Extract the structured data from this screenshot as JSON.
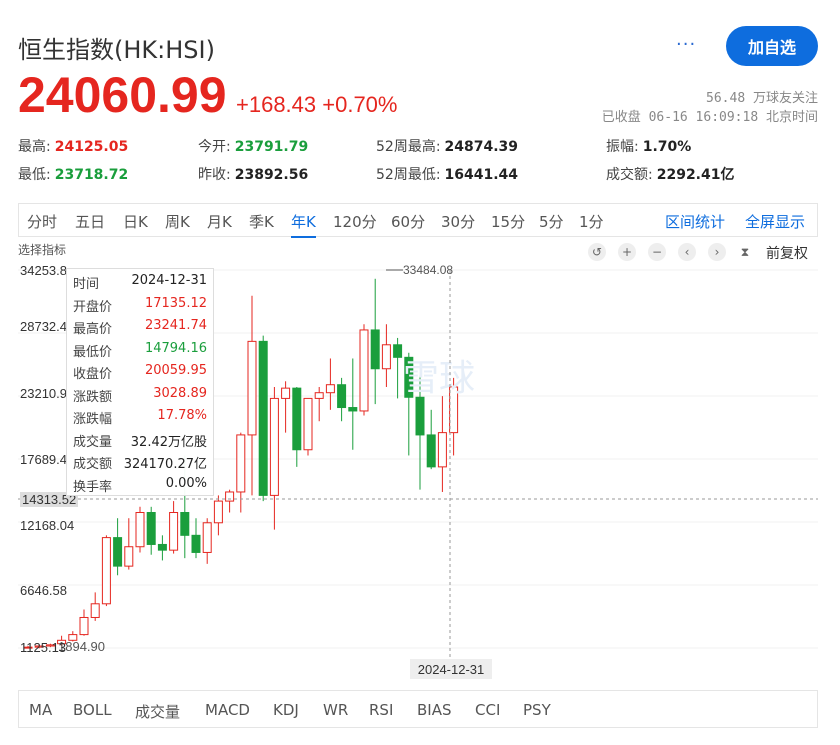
{
  "header": {
    "title": "恒生指数(HK:HSI)",
    "more_label": "···",
    "follow_button": "加自选",
    "price": "24060.99",
    "change": "+168.43 +0.70%",
    "follow_count": "56.48 万球友关注",
    "status": "已收盘 06-16 16:09:18 北京时间"
  },
  "stats": {
    "high_label": "最高:",
    "high": "24125.05",
    "low_label": "最低:",
    "low": "23718.72",
    "open_label": "今开:",
    "open": "23791.79",
    "prev_label": "昨收:",
    "prev": "23892.56",
    "w52h_label": "52周最高:",
    "w52h": "24874.39",
    "w52l_label": "52周最低:",
    "w52l": "16441.44",
    "amp_label": "振幅:",
    "amp": "1.70%",
    "turnover_label": "成交额:",
    "turnover": "2292.41亿"
  },
  "period_tabs": [
    "分时",
    "五日",
    "日K",
    "周K",
    "月K",
    "季K",
    "年K",
    "120分",
    "60分",
    "30分",
    "15分",
    "5分",
    "1分"
  ],
  "period_active": "年K",
  "right_links": {
    "stats": "区间统计",
    "fullscreen": "全屏显示"
  },
  "indicator_select": "选择指标",
  "toolbar": {
    "restore": "前复权"
  },
  "tooltip": {
    "time_label": "时间",
    "time": "2024-12-31",
    "open_label": "开盘价",
    "open": "17135.12",
    "high_label": "最高价",
    "high": "23241.74",
    "low_label": "最低价",
    "low": "14794.16",
    "close_label": "收盘价",
    "close": "20059.95",
    "chg_label": "涨跌额",
    "chg": "3028.89",
    "pct_label": "涨跌幅",
    "pct": "17.78%",
    "vol_label": "成交量",
    "vol": "32.42万亿股",
    "amt_label": "成交额",
    "amt": "324170.27亿",
    "turn_label": "换手率",
    "turn": "0.00%"
  },
  "watermark": "雪球",
  "crosshair_date": "2024-12-31",
  "crosshair_price": "14313.52",
  "max_annotation": "33484.08",
  "min_annotation": "1894.90",
  "indicator_tabs": [
    "MA",
    "BOLL",
    "成交量",
    "MACD",
    "KDJ",
    "WR",
    "RSI",
    "BIAS",
    "CCI",
    "PSY"
  ],
  "colors": {
    "up": "#e5261f",
    "down": "#1a9e3c",
    "accent": "#0e6dde"
  },
  "chart_data": {
    "type": "candlestick",
    "y_ticks": [
      "34253.8",
      "28732.4",
      "23210.9",
      "17689.4",
      "12168.04",
      "6646.58",
      "1125.13"
    ],
    "ylim": [
      1125.13,
      34253.8
    ],
    "candles": [
      {
        "o": 1125,
        "h": 1300,
        "l": 1125,
        "c": 1200
      },
      {
        "o": 1200,
        "h": 1400,
        "l": 1100,
        "c": 1300
      },
      {
        "o": 1300,
        "h": 1500,
        "l": 1200,
        "c": 1400
      },
      {
        "o": 1500,
        "h": 2200,
        "l": 1300,
        "c": 1800
      },
      {
        "o": 1800,
        "h": 2600,
        "l": 1700,
        "c": 2300
      },
      {
        "o": 2300,
        "h": 4500,
        "l": 2200,
        "c": 3800
      },
      {
        "o": 3800,
        "h": 6000,
        "l": 3500,
        "c": 5000
      },
      {
        "o": 5000,
        "h": 11000,
        "l": 4800,
        "c": 10800
      },
      {
        "o": 10800,
        "h": 12500,
        "l": 7500,
        "c": 8300
      },
      {
        "o": 8300,
        "h": 12500,
        "l": 8000,
        "c": 10000
      },
      {
        "o": 10000,
        "h": 13500,
        "l": 9500,
        "c": 13000
      },
      {
        "o": 13000,
        "h": 13500,
        "l": 9300,
        "c": 10200
      },
      {
        "o": 10200,
        "h": 11000,
        "l": 8800,
        "c": 9700
      },
      {
        "o": 9700,
        "h": 14000,
        "l": 9400,
        "c": 13000
      },
      {
        "o": 13000,
        "h": 18000,
        "l": 9000,
        "c": 11000
      },
      {
        "o": 11000,
        "h": 12500,
        "l": 9000,
        "c": 9500
      },
      {
        "o": 9500,
        "h": 12500,
        "l": 8500,
        "c": 12100
      },
      {
        "o": 12100,
        "h": 14500,
        "l": 11000,
        "c": 14000
      },
      {
        "o": 14000,
        "h": 15000,
        "l": 13000,
        "c": 14800
      },
      {
        "o": 14800,
        "h": 20000,
        "l": 13000,
        "c": 19800
      },
      {
        "o": 19800,
        "h": 32000,
        "l": 14500,
        "c": 28000
      },
      {
        "o": 28000,
        "h": 28500,
        "l": 14000,
        "c": 14500
      },
      {
        "o": 14500,
        "h": 24000,
        "l": 11500,
        "c": 23000
      },
      {
        "o": 23000,
        "h": 24500,
        "l": 20000,
        "c": 23900
      },
      {
        "o": 23900,
        "h": 24000,
        "l": 17000,
        "c": 18500
      },
      {
        "o": 18500,
        "h": 23000,
        "l": 18000,
        "c": 23000
      },
      {
        "o": 23000,
        "h": 24000,
        "l": 21000,
        "c": 23500
      },
      {
        "o": 23500,
        "h": 26500,
        "l": 22000,
        "c": 24200
      },
      {
        "o": 24200,
        "h": 24800,
        "l": 21000,
        "c": 22200
      },
      {
        "o": 22200,
        "h": 26500,
        "l": 18500,
        "c": 21900
      },
      {
        "o": 21900,
        "h": 29500,
        "l": 21500,
        "c": 29000
      },
      {
        "o": 29000,
        "h": 33484,
        "l": 22500,
        "c": 25600
      },
      {
        "o": 25600,
        "h": 29500,
        "l": 24000,
        "c": 27700
      },
      {
        "o": 27700,
        "h": 28300,
        "l": 23000,
        "c": 26600
      },
      {
        "o": 26600,
        "h": 27000,
        "l": 18000,
        "c": 23100
      },
      {
        "o": 23100,
        "h": 25000,
        "l": 15000,
        "c": 19800
      },
      {
        "o": 19800,
        "h": 22000,
        "l": 16800,
        "c": 17000
      },
      {
        "o": 17000,
        "h": 23200,
        "l": 14800,
        "c": 20000
      },
      {
        "o": 20000,
        "h": 24800,
        "l": 18000,
        "c": 24000
      }
    ]
  }
}
